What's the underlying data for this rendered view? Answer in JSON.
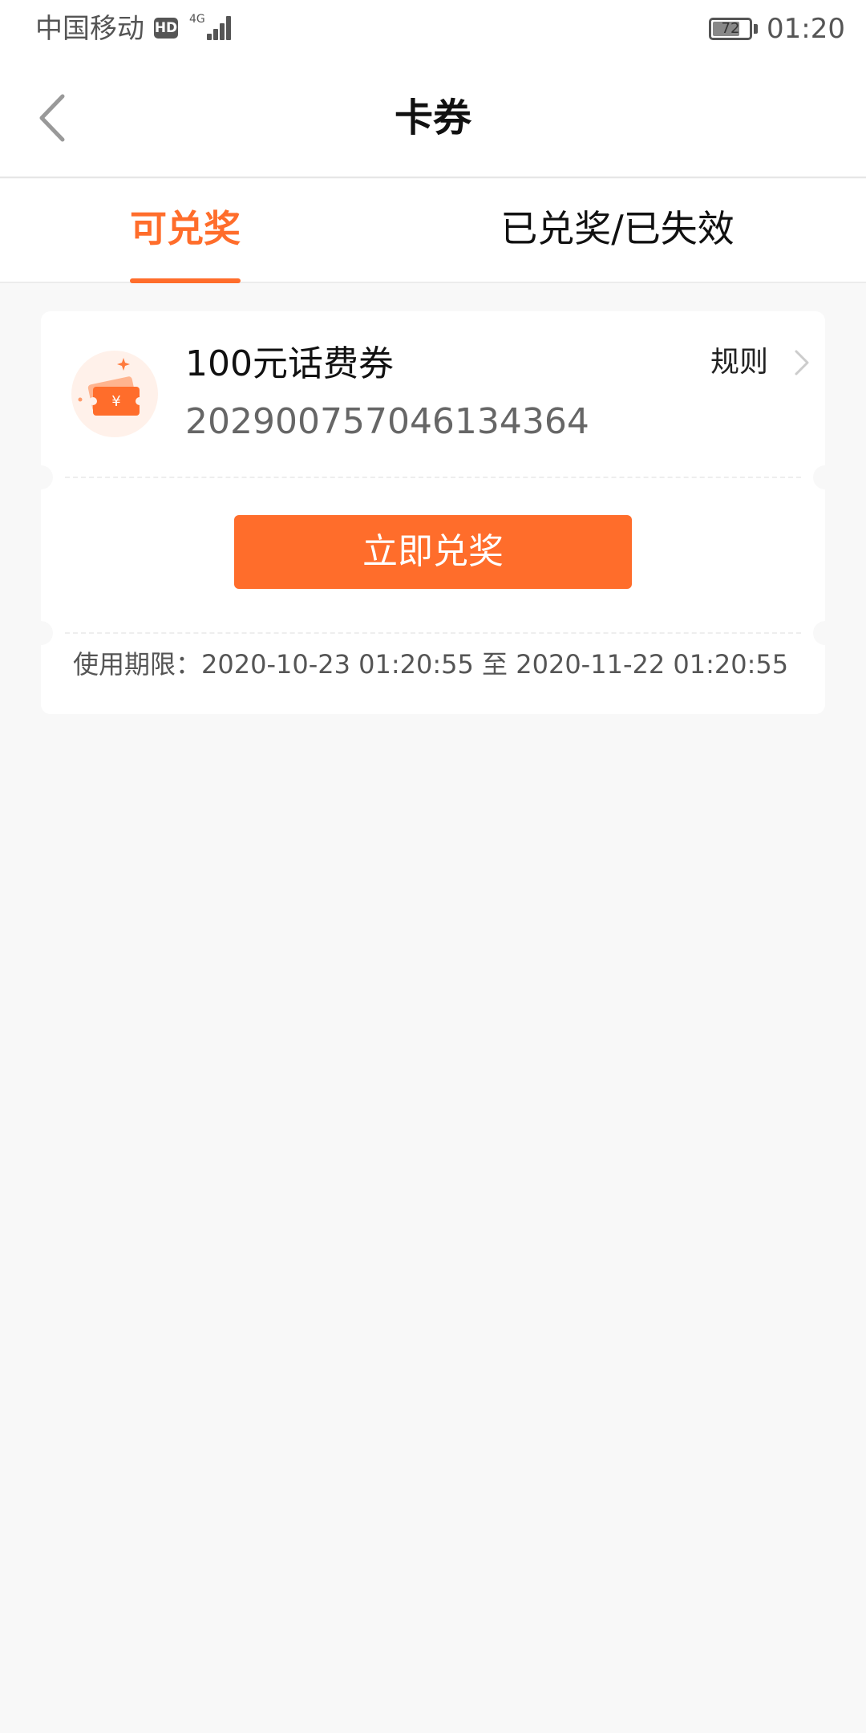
{
  "status_bar": {
    "carrier": "中国移动",
    "hd_badge": "HD",
    "network": "4G",
    "battery_level": "72",
    "time": "01:20"
  },
  "nav": {
    "title": "卡券",
    "back_icon": "chevron-left-icon"
  },
  "tabs": [
    {
      "label": "可兑奖",
      "active": true
    },
    {
      "label": "已兑奖/已失效",
      "active": false
    }
  ],
  "coupon": {
    "name": "100元话费券",
    "code": "202900757046134364",
    "rules_label": "规则",
    "icon_symbol": "¥",
    "redeem_label": "立即兑奖",
    "validity_label": "使用期限：",
    "validity_start": "2020-10-23 01:20:55",
    "validity_sep": "至",
    "validity_end": "2020-11-22 01:20:55"
  },
  "colors": {
    "accent": "#ff6d2b",
    "background": "#f8f8f8"
  }
}
